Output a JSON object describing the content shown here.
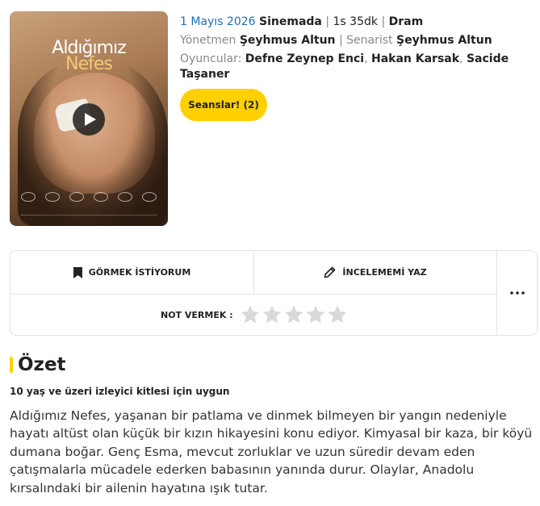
{
  "poster": {
    "title_line1": "Aldığımız",
    "title_line2": "Nefes"
  },
  "movie": {
    "release_date": "1 Mayıs 2026",
    "status": "Sinemada",
    "duration": "1s 35dk",
    "genre": "Dram",
    "director_label": "Yönetmen",
    "director": "Şeyhmus Altun",
    "writer_label": "Senarist",
    "writer": "Şeyhmus Altun",
    "cast_label": "Oyuncular:",
    "cast": [
      "Defne Zeynep Enci",
      "Hakan Karsak",
      "Sacide Taşaner"
    ],
    "sessions_button": "Seanslar! (2)"
  },
  "actions": {
    "watch_label": "GÖRMEK İSTİYORUM",
    "review_label": "İNCELEMEMİ YAZ",
    "rate_label": "NOT VERMEK :",
    "rating_value": 0,
    "rating_max": 5
  },
  "summary": {
    "title": "Özet",
    "age_note": "10 yaş ve üzeri izleyici kitlesi için uygun",
    "text": "Aldığımız Nefes, yaşanan bir patlama ve dinmek bilmeyen bir yangın nedeniyle hayatı altüst olan küçük bir kızın hikayesini konu ediyor. Kimyasal bir kaza, bir köyü dumana boğar. Genç Esma, mevcut zorluklar ve uzun süredir devam eden çatışmalarla mücadele ederken babasının yanında durur. Olaylar, Anadolu kırsalındaki bir ailenin hayatına ışık tutar."
  },
  "colors": {
    "accent": "#ffd000",
    "link": "#1e6fb5",
    "star_inactive": "#d9d9d9"
  }
}
